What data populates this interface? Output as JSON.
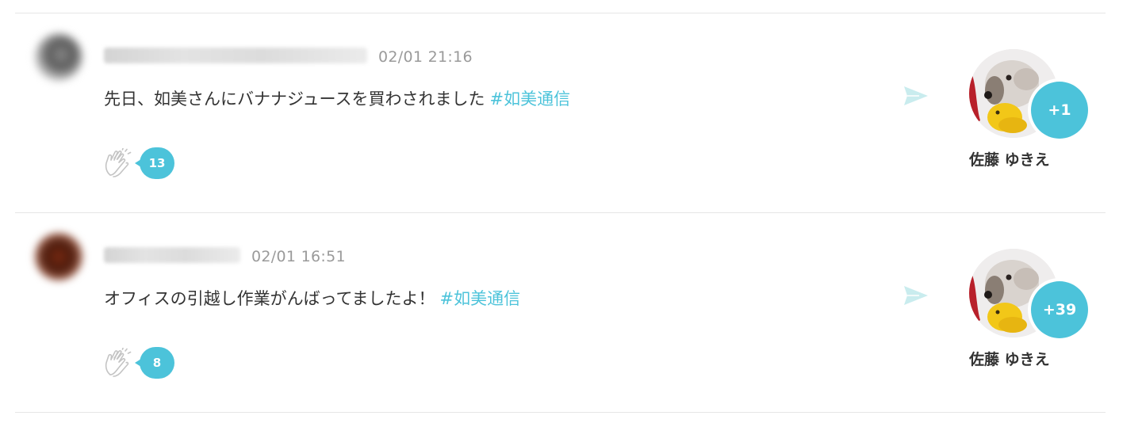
{
  "posts": [
    {
      "timestamp": "02/01 21:16",
      "message": "先日、如美さんにバナナジュースを買わされました",
      "hashtag": "#如美通信",
      "clap_count": "13",
      "recipient": {
        "plus_count": "+1",
        "name": "佐藤 ゆきえ"
      }
    },
    {
      "timestamp": "02/01 16:51",
      "message": "オフィスの引越し作業がんばってましたよ！",
      "hashtag": "#如美通信",
      "clap_count": "8",
      "recipient": {
        "plus_count": "+39",
        "name": "佐藤 ゆきえ"
      }
    }
  ],
  "icons": {
    "clap": "clap-icon",
    "send": "send-icon"
  },
  "colors": {
    "accent": "#4cc3da",
    "send_icon": "#c9ecee",
    "divider": "#e6e6e6",
    "timestamp": "#9a9a9a",
    "text": "#333333"
  }
}
